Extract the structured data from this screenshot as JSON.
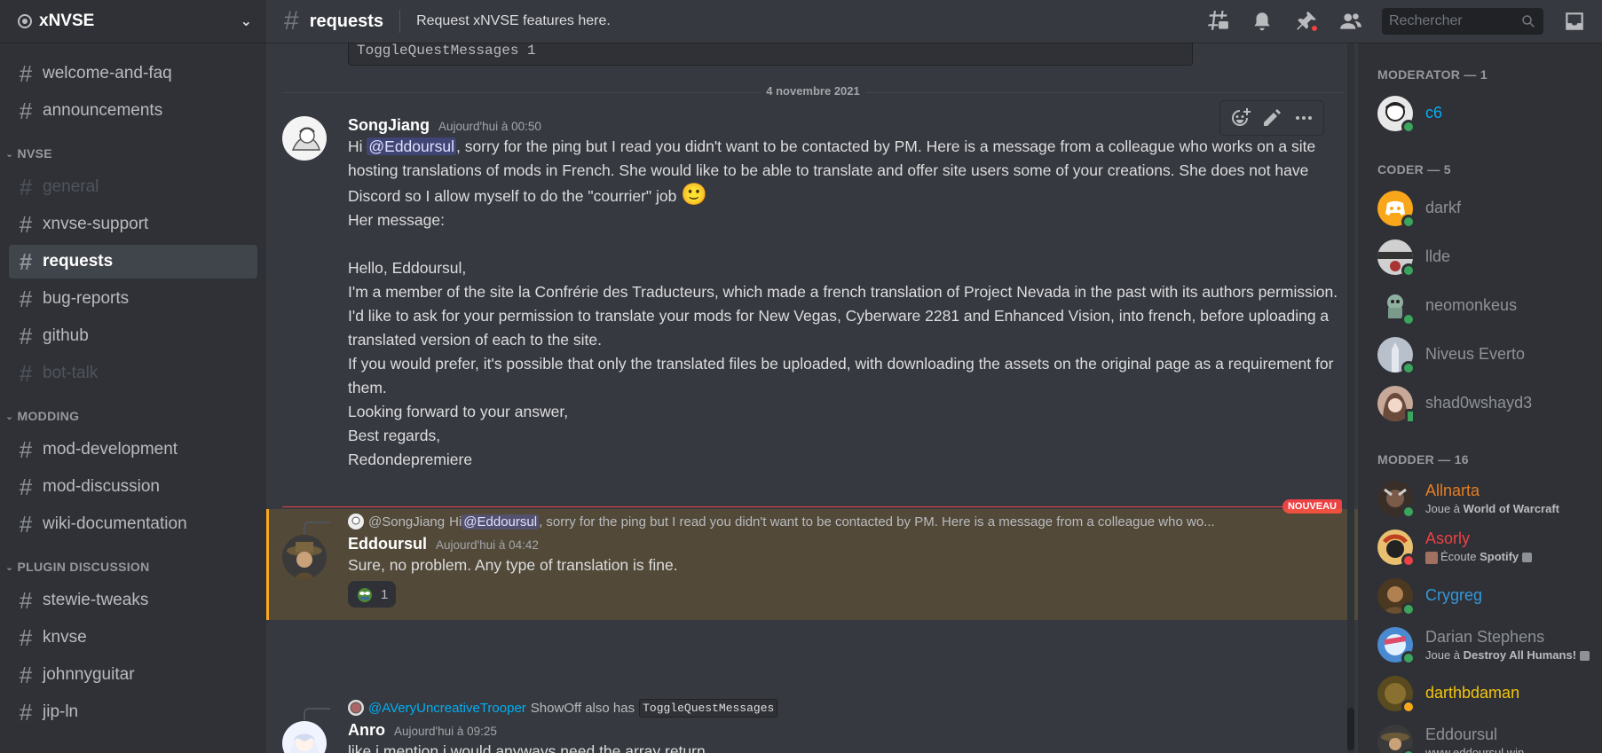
{
  "server": {
    "name": "xNVSE"
  },
  "channels": {
    "top": [
      {
        "label": "welcome-and-faq"
      },
      {
        "label": "announcements"
      }
    ],
    "categories": [
      {
        "label": "NVSE",
        "items": [
          {
            "label": "general",
            "muted": true
          },
          {
            "label": "xnvse-support"
          },
          {
            "label": "requests",
            "active": true
          },
          {
            "label": "bug-reports"
          },
          {
            "label": "github"
          },
          {
            "label": "bot-talk",
            "muted": true
          }
        ]
      },
      {
        "label": "MODDING",
        "items": [
          {
            "label": "mod-development"
          },
          {
            "label": "mod-discussion"
          },
          {
            "label": "wiki-documentation"
          }
        ]
      },
      {
        "label": "PLUGIN DISCUSSION",
        "items": [
          {
            "label": "stewie-tweaks"
          },
          {
            "label": "knvse"
          },
          {
            "label": "johnnyguitar"
          },
          {
            "label": "jip-ln"
          }
        ]
      }
    ]
  },
  "header": {
    "channel": "requests",
    "topic": "Request xNVSE features here.",
    "search_placeholder": "Rechercher"
  },
  "chat": {
    "prev_code": "ToggleQuestMessages 1",
    "date_divider": "4 novembre 2021",
    "new_badge": "NOUVEAU",
    "msg1": {
      "author": "SongJiang",
      "time": "Aujourd'hui à 00:50",
      "hi": "Hi ",
      "mention": "@Eddoursul",
      "text1": ", sorry for the ping but I read you didn't want to be contacted by PM. Here is a message from a colleague who works on a site hosting translations of mods in French. She would like to be able to translate and offer site users some of your creations. She does not have Discord so I allow myself to do the \"courrier\" job",
      "emoji": "🙂",
      "text2": "Her message:\n\nHello, Eddoursul,\nI'm a member of the site la Confrérie des Traducteurs, which made a french translation of Project Nevada in the past with its authors permission.\nI'd like to ask for your permission to translate your mods for New Vegas, Cyberware 2281 and Enhanced Vision, into french, before uploading a translated version of each to the site.\nIf you would prefer, it's possible that only the translated files be uploaded, with downloading the assets on the original page as a requirement for them.\nLooking forward to your answer,\nBest regards,\nRedondepremiere"
    },
    "msg2": {
      "reply_author": "@SongJiang",
      "reply_hi": "Hi ",
      "reply_mention": "@Eddoursul",
      "reply_text": ", sorry for the ping but I read you didn't want to be contacted by PM. Here is a message from a colleague who wo...",
      "author": "Eddoursul",
      "time": "Aujourd'hui à 04:42",
      "text": "Sure, no problem. Any type of translation is fine.",
      "reaction_count": "1"
    },
    "msg3": {
      "reply_author": "@AVeryUncreativeTrooper",
      "reply_text": "ShowOff also has",
      "reply_code": "ToggleQuestMessages",
      "author": "Anro",
      "time": "Aujourd'hui à 09:25",
      "text": "like i mention i would anyways need the array return"
    }
  },
  "members": {
    "groups": [
      {
        "label": "MODERATOR — 1",
        "items": [
          {
            "name": "c6",
            "color": "#00aff4",
            "status": "online",
            "avatar_color": "#d8d8d8"
          }
        ]
      },
      {
        "label": "CODER — 5",
        "items": [
          {
            "name": "darkf",
            "color": "#8e9297",
            "status": "online",
            "avatar_color": "#faa61a"
          },
          {
            "name": "llde",
            "color": "#8e9297",
            "status": "online",
            "avatar_color": "#c8c8c8"
          },
          {
            "name": "neomonkeus",
            "color": "#8e9297",
            "status": "online",
            "avatar_color": "#6a8a7a"
          },
          {
            "name": "Niveus Everto",
            "color": "#8e9297",
            "status": "online",
            "avatar_color": "#9aa4b0"
          },
          {
            "name": "shad0wshayd3",
            "color": "#8e9297",
            "status": "mobile",
            "avatar_color": "#a07a6a"
          }
        ]
      },
      {
        "label": "MODDER — 16",
        "items": [
          {
            "name": "Allnarta",
            "color": "#e67e22",
            "status": "online",
            "avatar_color": "#4a3a30",
            "activity_prefix": "Joue à ",
            "activity": "World of Warcraft"
          },
          {
            "name": "Asorly",
            "color": "#ed4245",
            "status": "dnd",
            "avatar_color": "#c07030",
            "activity_prefix": "Écoute ",
            "activity": "Spotify"
          },
          {
            "name": "Crygreg",
            "color": "#3498db",
            "status": "online",
            "avatar_color": "#6a5030"
          },
          {
            "name": "Darian Stephens",
            "color": "#8e9297",
            "status": "online",
            "avatar_color": "#5a8ac0",
            "activity_prefix": "Joue à ",
            "activity": "Destroy All Humans!"
          },
          {
            "name": "darthbdaman",
            "color": "#f1c40f",
            "status": "idle",
            "avatar_color": "#5a4a20"
          },
          {
            "name": "Eddoursul",
            "color": "#8e9297",
            "status": "online",
            "avatar_color": "#5a4a3a",
            "activity": "www.eddoursul.win"
          }
        ]
      }
    ]
  },
  "colors": {
    "accent": "#5865f2",
    "online": "#3ba55d",
    "idle": "#faa81a",
    "dnd": "#ed4245",
    "new": "#ed4245",
    "highlight": "#faa81a"
  }
}
